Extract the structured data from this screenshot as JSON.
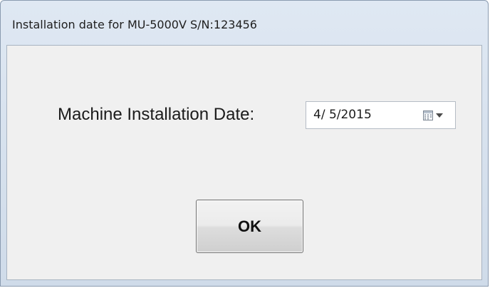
{
  "window": {
    "title": "Installation date for MU-5000V S/N:123456"
  },
  "form": {
    "installation_date_label": "Machine Installation Date:",
    "installation_date_value": "4/ 5/2015"
  },
  "buttons": {
    "ok_label": "OK"
  },
  "icons": {
    "calendar": "calendar-icon",
    "dropdown": "chevron-down-icon"
  }
}
